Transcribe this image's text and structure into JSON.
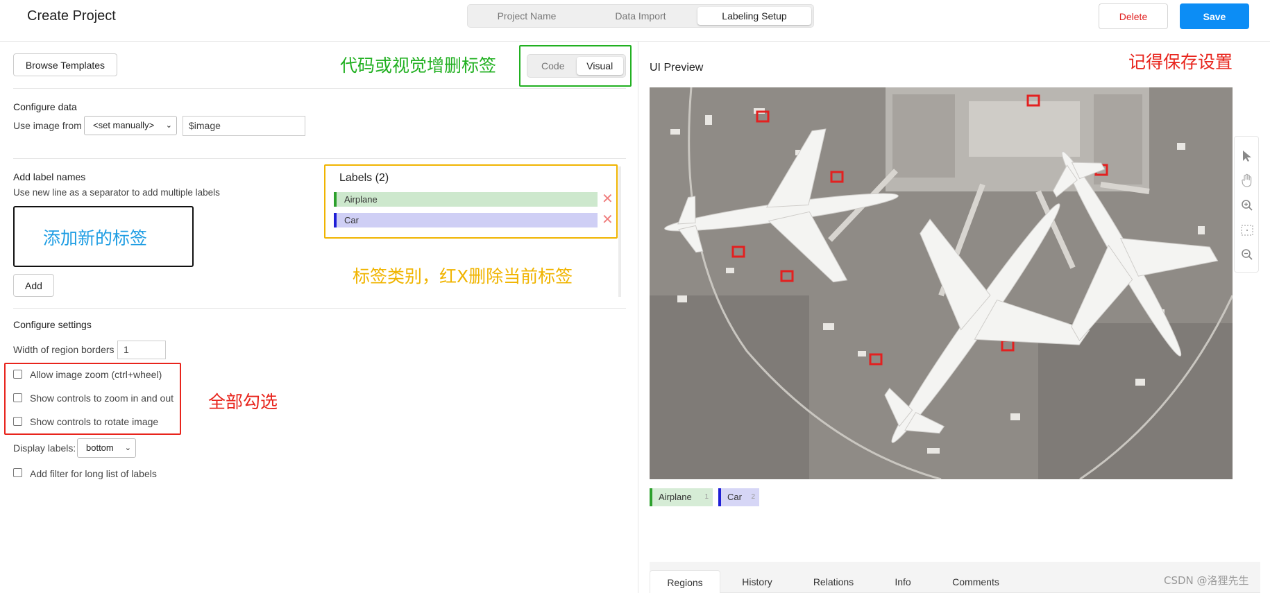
{
  "header": {
    "title": "Create Project",
    "steps": [
      "Project Name",
      "Data Import",
      "Labeling Setup"
    ],
    "active_step": "Labeling Setup",
    "delete_label": "Delete",
    "save_label": "Save"
  },
  "colors": {
    "accent": "#0c8df5",
    "danger": "#e02020",
    "airplane": "#2ca02c",
    "car": "#1f1fd6",
    "ann_green": "#21b021",
    "ann_yellow": "#f0b400",
    "ann_red": "#e8241c",
    "ann_blue": "#1e9de3"
  },
  "config": {
    "browse_templates": "Browse Templates",
    "code_label": "Code",
    "visual_label": "Visual",
    "configure_data_title": "Configure data",
    "use_image_from": "Use image from",
    "image_source_selected": "<set manually>",
    "image_field_value": "$image",
    "add_label_names_title": "Add label names",
    "add_label_hint": "Use new line as a separator to add multiple labels",
    "add_button": "Add",
    "labels_title": "Labels (2)",
    "labels": [
      {
        "name": "Airplane",
        "color": "#2ca02c"
      },
      {
        "name": "Car",
        "color": "#1f1fd6"
      }
    ],
    "configure_settings_title": "Configure settings",
    "width_label": "Width of region borders",
    "width_value": "1",
    "checkboxes": [
      {
        "label": "Allow image zoom (ctrl+wheel)",
        "checked": false
      },
      {
        "label": "Show controls to zoom in and out",
        "checked": false
      },
      {
        "label": "Show controls to rotate image",
        "checked": false
      }
    ],
    "display_labels_label": "Display labels:",
    "display_labels_value": "bottom",
    "filter_label": "Add filter for long list of labels",
    "filter_checked": false
  },
  "annotations": {
    "code_visual": "代码或视觉增删标签",
    "save_reminder": "记得保存设置",
    "add_new_label": "添加新的标签",
    "label_categories": "标签类别，红X删除当前标签",
    "check_all": "全部勾选"
  },
  "preview": {
    "title": "UI Preview",
    "chips": [
      {
        "name": "Airplane",
        "hotkey": "1"
      },
      {
        "name": "Car",
        "hotkey": "2"
      }
    ],
    "tools": [
      "pointer-icon",
      "hand-icon",
      "zoom-in-icon",
      "fit-icon",
      "zoom-out-icon"
    ],
    "tabs": [
      "Regions",
      "History",
      "Relations",
      "Info",
      "Comments"
    ],
    "active_tab": "Regions"
  },
  "watermark": "CSDN @洛狸先生"
}
